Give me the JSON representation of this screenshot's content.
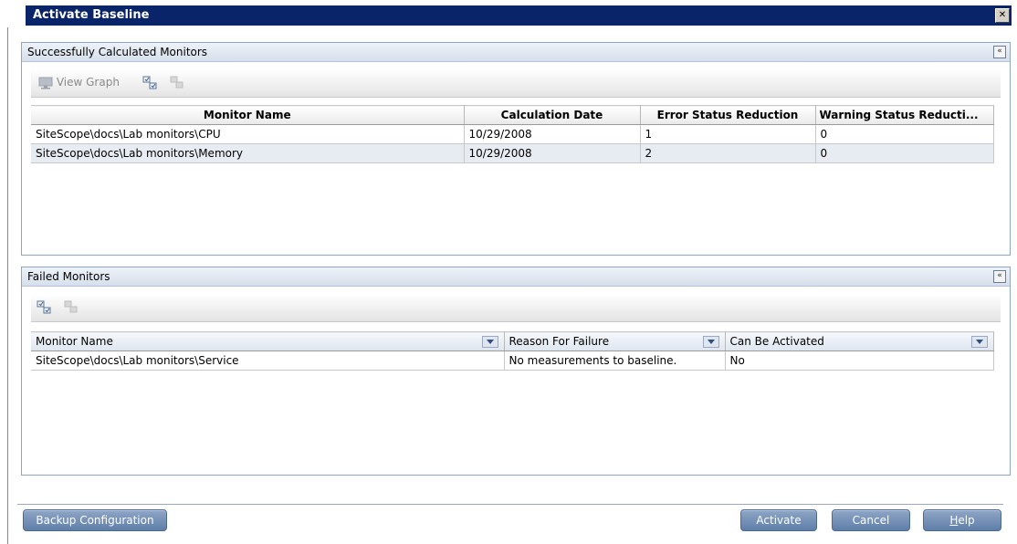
{
  "window": {
    "title": "Activate Baseline",
    "close_glyph": "✕"
  },
  "success_panel": {
    "title": "Successfully Calculated Monitors",
    "toolbar": {
      "view_graph_label": "View Graph"
    },
    "columns": [
      "Monitor Name",
      "Calculation Date",
      "Error Status Reduction",
      "Warning Status Reducti..."
    ],
    "rows": [
      {
        "monitor": "SiteScope\\docs\\Lab monitors\\CPU",
        "date": "10/29/2008",
        "error": "1",
        "warning": "0"
      },
      {
        "monitor": "SiteScope\\docs\\Lab monitors\\Memory",
        "date": "10/29/2008",
        "error": "2",
        "warning": "0"
      }
    ]
  },
  "failed_panel": {
    "title": "Failed Monitors",
    "columns": [
      "Monitor Name",
      "Reason For Failure",
      "Can Be Activated"
    ],
    "rows": [
      {
        "monitor": "SiteScope\\docs\\Lab monitors\\Service",
        "reason": "No measurements to baseline.",
        "activated": "No"
      }
    ]
  },
  "buttons": {
    "backup": "Backup Configuration",
    "activate": "Activate",
    "cancel": "Cancel",
    "help_prefix": "H",
    "help_rest": "elp"
  }
}
